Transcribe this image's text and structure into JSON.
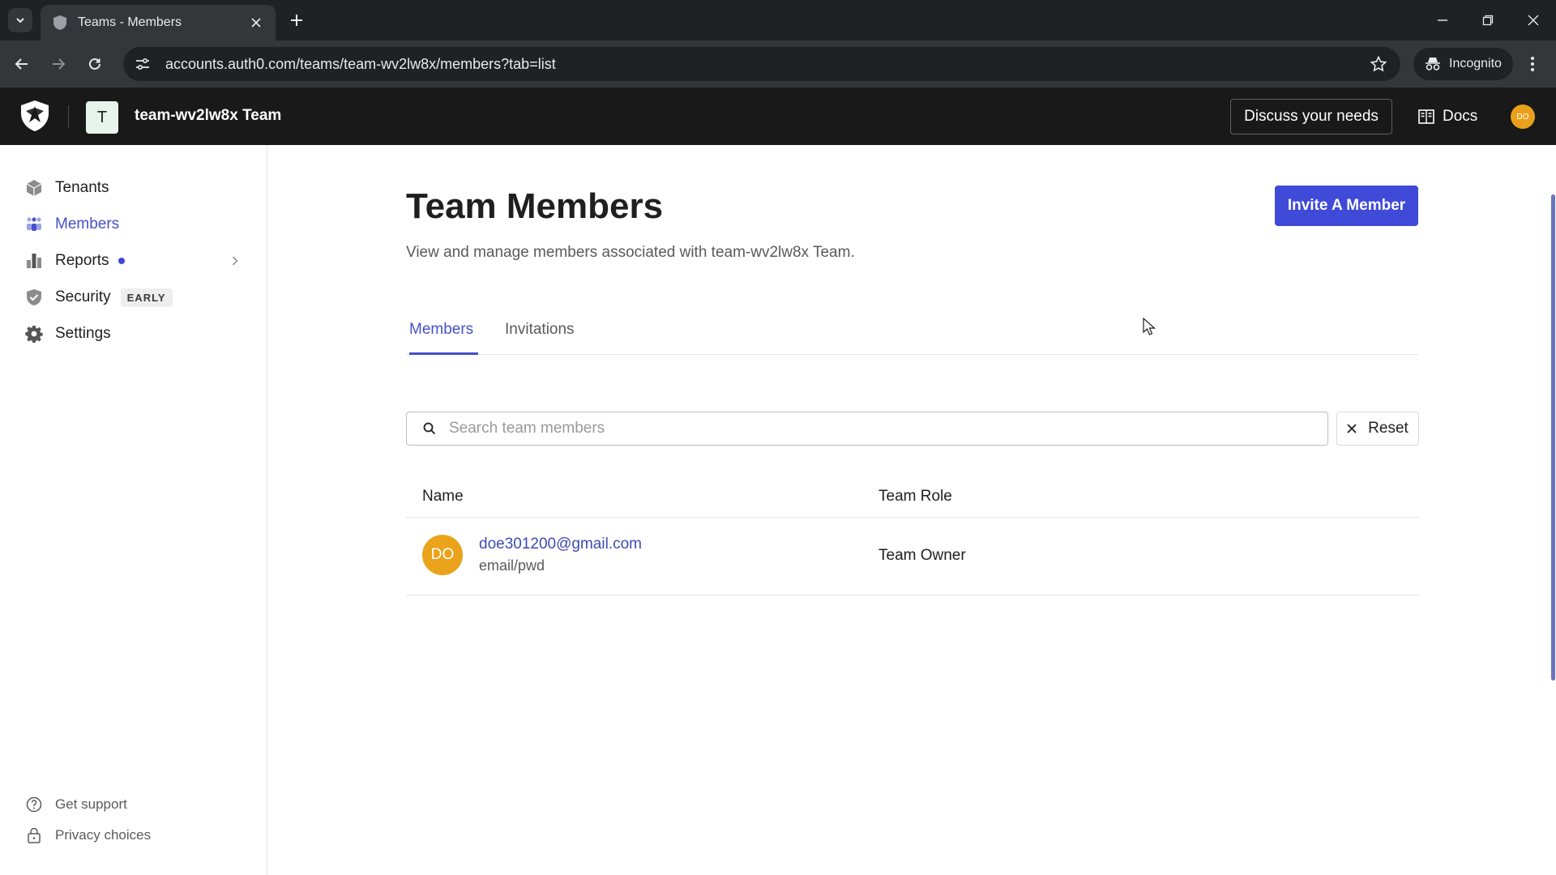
{
  "browser": {
    "tab_title": "Teams - Members",
    "url": "accounts.auth0.com/teams/team-wv2lw8x/members?tab=list",
    "incognito_label": "Incognito"
  },
  "header": {
    "team_initial": "T",
    "team_name": "team-wv2lw8x Team",
    "discuss_label": "Discuss your needs",
    "docs_label": "Docs",
    "avatar_initials": "DO",
    "avatar_color": "#e9a11b"
  },
  "sidebar": {
    "items": [
      {
        "label": "Tenants",
        "icon": "cube-icon"
      },
      {
        "label": "Members",
        "icon": "people-icon",
        "active": true
      },
      {
        "label": "Reports",
        "icon": "bar-chart-icon",
        "has_dot": true,
        "has_chevron": true
      },
      {
        "label": "Security",
        "icon": "shield-check-icon",
        "badge": "EARLY"
      },
      {
        "label": "Settings",
        "icon": "gear-icon"
      }
    ],
    "footer": [
      {
        "label": "Get support",
        "icon": "help-circle-icon"
      },
      {
        "label": "Privacy choices",
        "icon": "lock-icon"
      }
    ]
  },
  "main": {
    "title": "Team Members",
    "description": "View and manage members associated with team-wv2lw8x Team.",
    "invite_label": "Invite A Member",
    "tabs": [
      {
        "label": "Members",
        "active": true
      },
      {
        "label": "Invitations",
        "active": false
      }
    ],
    "search": {
      "placeholder": "Search team members",
      "value": ""
    },
    "reset_label": "Reset",
    "table": {
      "columns": [
        "Name",
        "Team Role"
      ],
      "rows": [
        {
          "initials": "DO",
          "email": "doe301200@gmail.com",
          "connection": "email/pwd",
          "role": "Team Owner"
        }
      ]
    }
  },
  "colors": {
    "accent": "#3f4ad8",
    "link": "#3e4ab3",
    "header_bg": "#191919",
    "member_avatar": "#eaa31b"
  }
}
